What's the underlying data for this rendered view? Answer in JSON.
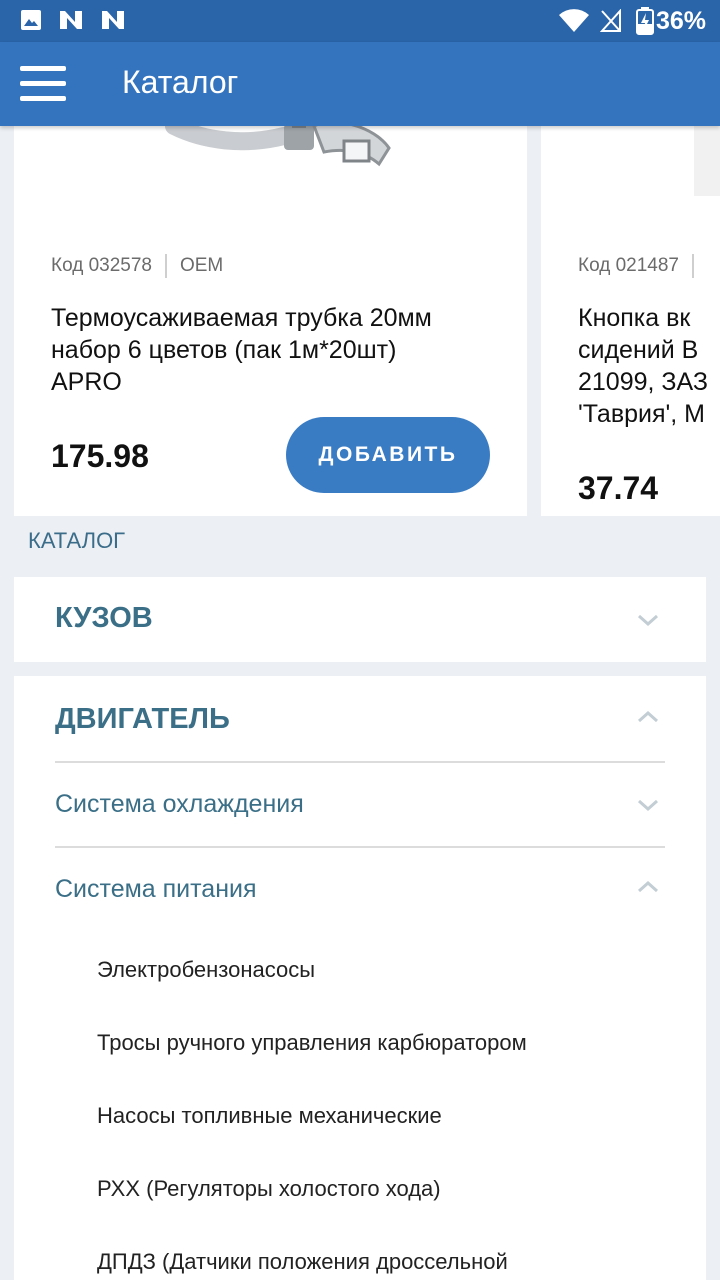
{
  "status_bar": {
    "battery": "36%"
  },
  "app_bar": {
    "title": "Каталог"
  },
  "products": [
    {
      "code": "Код 032578",
      "brand": "OEM",
      "name_lines": [
        "Термоусаживаемая трубка 20мм",
        "набор 6 цветов (пак 1м*20шт)",
        "APRO"
      ],
      "price": "175.98",
      "button": "ДОБАВИТЬ"
    },
    {
      "code": "Код 021487",
      "name_lines": [
        "Кнопка вк",
        "сидений В",
        "21099, ЗАЗ",
        "'Таврия', М"
      ],
      "price": "37.74"
    }
  ],
  "catalog": {
    "section_label": "КАТАЛОГ",
    "categories": [
      {
        "title": "КУЗОВ"
      },
      {
        "title": "ДВИГАТЕЛЬ",
        "subcategories": [
          {
            "title": "Система охлаждения"
          },
          {
            "title": "Система питания",
            "items": [
              "Электробензонасосы",
              "Тросы ручного управления карбюратором",
              "Насосы топливные механические",
              "РХХ (Регуляторы холостого хода)",
              "ДПДЗ (Датчики положения дроссельной"
            ]
          }
        ]
      }
    ]
  },
  "colors": {
    "primary": "#3474bf",
    "status_bar": "#2a64a9",
    "button": "#3a7cc4",
    "category_text": "#3a6f87",
    "background": "#eceff3"
  }
}
